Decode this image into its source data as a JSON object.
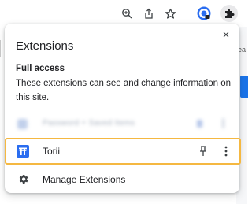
{
  "background": {
    "fragment_text": "ea"
  },
  "toolbar": {
    "icons": [
      "zoom-icon",
      "share-icon",
      "bookmark-star-icon",
      "profile-icon",
      "extensions-puzzle-icon"
    ]
  },
  "panel": {
    "title": "Extensions",
    "close_label": "×",
    "section_heading": "Full access",
    "section_desc": "These extensions can see and change information on this site.",
    "blurred_item": "Password + Saved Items",
    "extension_item": {
      "name": "Torii",
      "icon": "torii-icon"
    },
    "manage_label": "Manage Extensions"
  },
  "colors": {
    "highlight_border": "#f5b841",
    "torii_blue": "#2a6df0",
    "text": "#202124"
  }
}
